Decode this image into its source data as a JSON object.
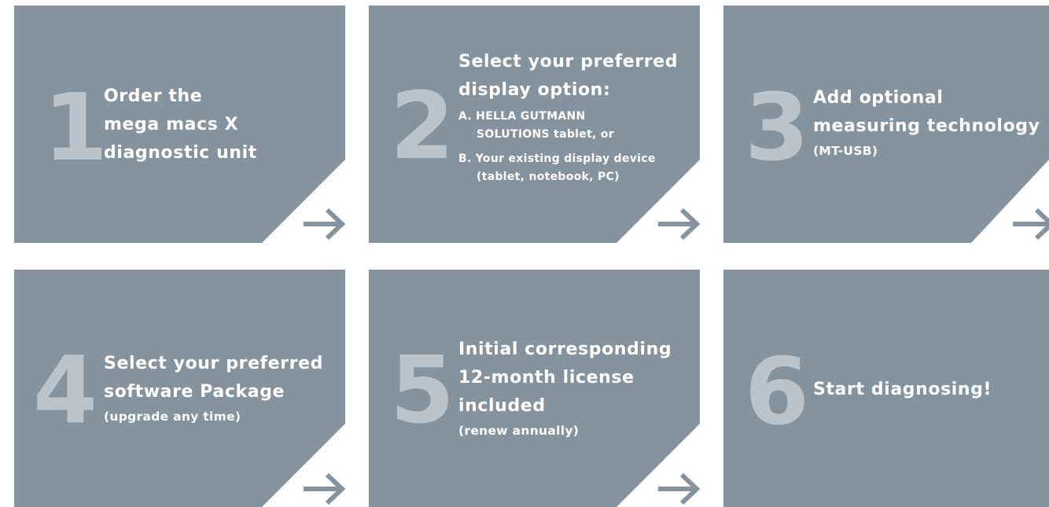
{
  "steps": [
    {
      "number": "1",
      "lines": [
        "Order the",
        "mega macs X",
        "diagnostic unit"
      ]
    },
    {
      "number": "2",
      "lines": [
        "Select your preferred",
        "display option:"
      ],
      "options": [
        {
          "label": "A. HELLA GUTMANN"
        },
        {
          "label": "SOLUTIONS tablet, or"
        },
        {
          "label": "B. Your existing display device"
        },
        {
          "label": "(tablet, notebook, PC)"
        }
      ]
    },
    {
      "number": "3",
      "lines": [
        "Add optional",
        "measuring technology"
      ],
      "note": "(MT-USB)"
    },
    {
      "number": "4",
      "lines": [
        "Select your preferred",
        "software Package"
      ],
      "note": "(upgrade any time)"
    },
    {
      "number": "5",
      "lines": [
        "Initial corresponding",
        "12-month license",
        "included"
      ],
      "note": "(renew annually)"
    },
    {
      "number": "6",
      "lines": [
        "Start diagnosing!"
      ]
    }
  ],
  "icons": {
    "arrow": "arrow-right-icon"
  },
  "colors": {
    "card": "#84939e",
    "number": "#bcc4cb",
    "text": "#ffffff",
    "background": "#ffffff"
  }
}
